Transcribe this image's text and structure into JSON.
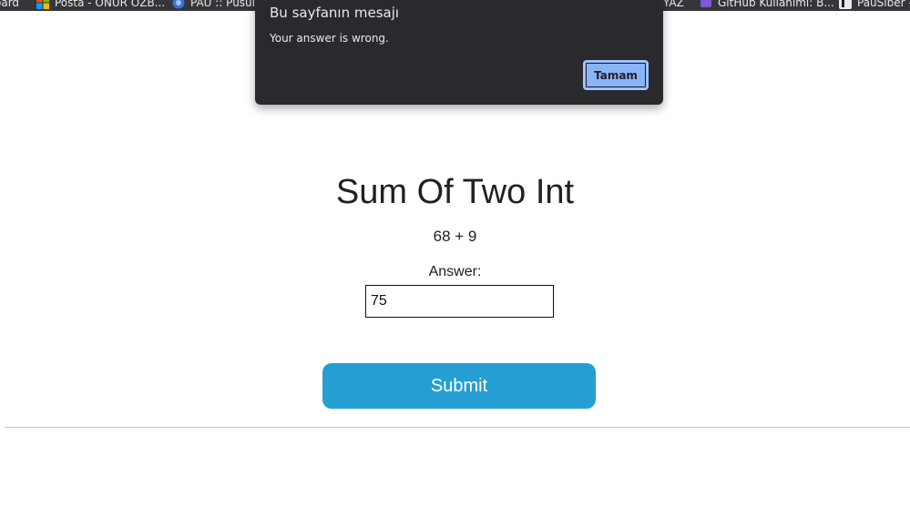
{
  "bookmarks": [
    {
      "label": "oard",
      "icon": "dashboard-icon"
    },
    {
      "label": "Posta - ONUR ÖZB...",
      "icon": "windows-icon"
    },
    {
      "label": "PAÜ :: Pusula",
      "icon": "university-icon"
    },
    {
      "label": "YAZ",
      "icon": "none"
    },
    {
      "label": "GitHub Kullanımı: B...",
      "icon": "github-icon"
    },
    {
      "label": "PaüSiber -",
      "icon": "app-icon"
    }
  ],
  "dialog": {
    "title": "Bu sayfanın mesajı",
    "message": "Your answer is wrong.",
    "ok_label": "Tamam"
  },
  "main": {
    "title": "Sum Of Two Int",
    "problem": "68 + 9",
    "answer_label": "Answer:",
    "answer_value": "75",
    "submit_label": "Submit"
  },
  "colors": {
    "submit": "#259fd3",
    "dialog_bg": "#292a2d",
    "dialog_ok": "#8ab4f8",
    "bookmarks_bar": "#35363a"
  }
}
